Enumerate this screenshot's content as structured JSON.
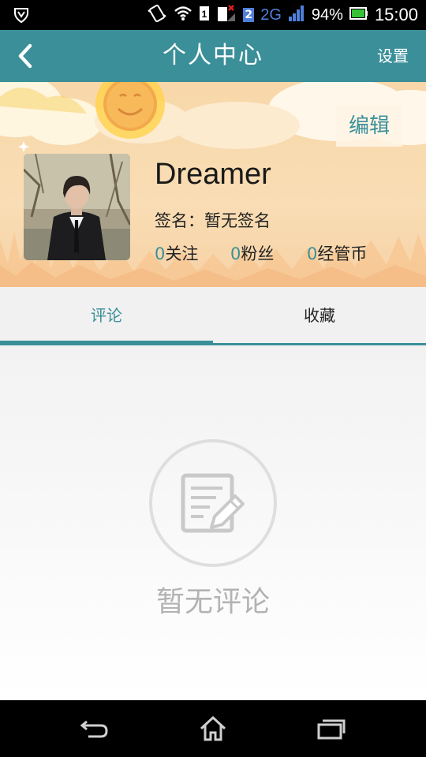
{
  "status_bar": {
    "battery": "94%",
    "network": "2G",
    "sim_slot": "2",
    "time": "15:00"
  },
  "header": {
    "title": "个人中心",
    "settings_label": "设置"
  },
  "profile": {
    "edit_label": "编辑",
    "username": "Dreamer",
    "signature": "签名：暂无签名",
    "stats": [
      {
        "value": "0",
        "label": "关注"
      },
      {
        "value": "0",
        "label": "粉丝"
      },
      {
        "value": "0",
        "label": "经管币"
      }
    ]
  },
  "tabs": [
    {
      "label": "评论",
      "active": true
    },
    {
      "label": "收藏",
      "active": false
    }
  ],
  "empty_state": {
    "icon": "edit-document-icon",
    "text": "暂无评论"
  },
  "colors": {
    "accent": "#3a8f98",
    "banner": "#f9ddb4",
    "empty_text": "#b3b3b3"
  }
}
